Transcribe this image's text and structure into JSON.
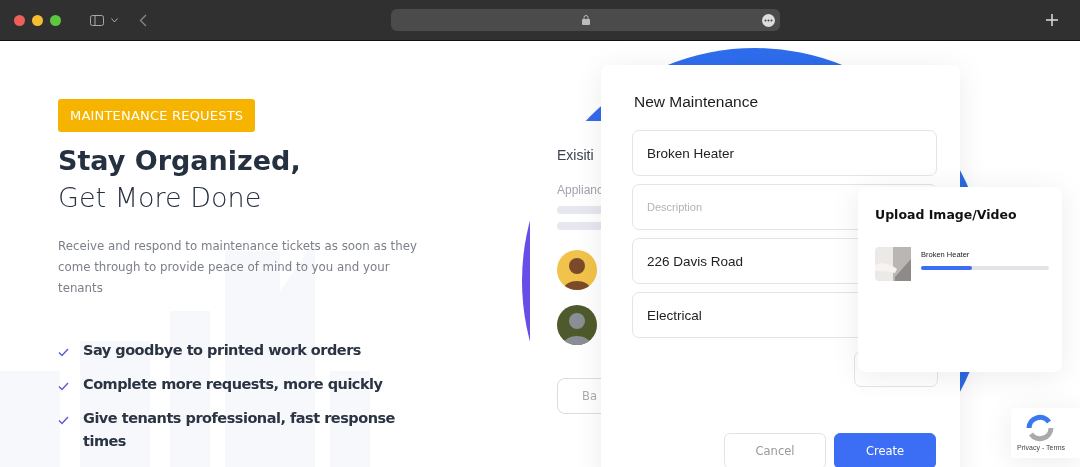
{
  "hero": {
    "badge": "MAINTENANCE REQUESTS",
    "title_bold": "Stay Organized,",
    "title_light": "Get More Done",
    "description": "Receive and respond to maintenance tickets as soon as they come through to provide peace of mind to you and your tenants",
    "features": [
      "Say goodbye to printed work orders",
      "Complete more requests, more quickly",
      "Give tenants professional, fast response times"
    ]
  },
  "existing_card": {
    "title": "Exisiti",
    "subtitle": "Applianc",
    "avatars": [
      {
        "color": "#f2c34a"
      },
      {
        "color": "#4f5a2c"
      }
    ],
    "button": "Ba"
  },
  "modal": {
    "title": "New Maintenance",
    "fields": [
      {
        "value": "Broken Heater"
      },
      {
        "placeholder": "Description"
      },
      {
        "value": "226 Davis Road"
      },
      {
        "value": "Electrical"
      }
    ],
    "buttons": [
      {
        "label": "Cancel",
        "kind": "secondary"
      },
      {
        "label": "Create",
        "kind": "primary"
      }
    ]
  },
  "upload": {
    "title": "Upload Image/Video",
    "files": [
      {
        "name": "Broken Heater",
        "level": 0.4
      }
    ]
  },
  "recaptcha": {
    "links": "Privacy - Terms"
  }
}
